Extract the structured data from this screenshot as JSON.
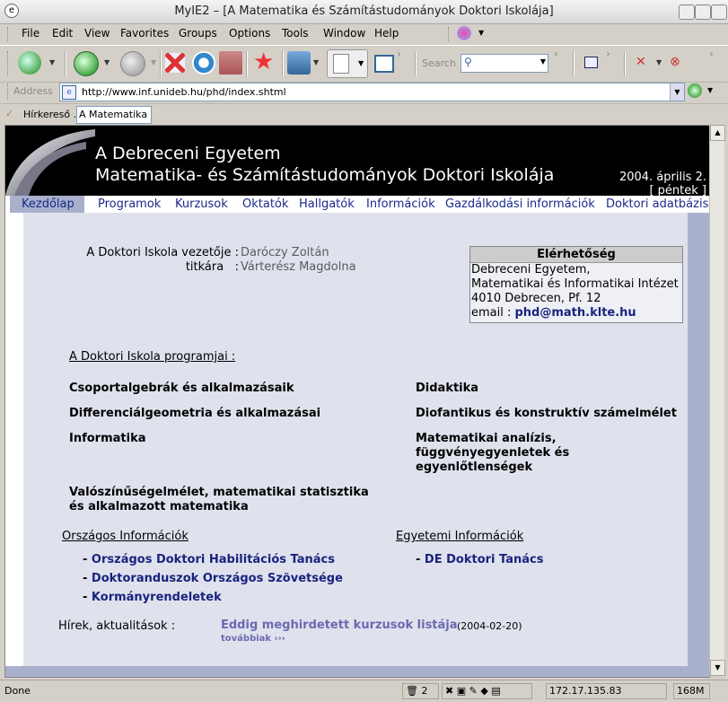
{
  "window": {
    "title": "MyIE2 – [A Matematika és Számítástudományok Doktori Iskolája]"
  },
  "menu": [
    "File",
    "Edit",
    "View",
    "Favorites",
    "Groups",
    "Options",
    "Tools",
    "Window",
    "Help"
  ],
  "toolbar": {
    "search_label": "Search"
  },
  "address": {
    "label": "Address",
    "url": "http://www.inf.unideb.hu/phd/index.shtml"
  },
  "tabs": {
    "hirkereso": "Hírkereső ...",
    "active": "A Matematika ..."
  },
  "page": {
    "header": {
      "line1": "A Debreceni Egyetem",
      "line2": "Matematika- és Számítástudományok Doktori Iskolája",
      "date": "2004. április 2.",
      "day": "[ péntek ]"
    },
    "nav": [
      "Kezdőlap",
      "Programok",
      "Kurzusok",
      "Oktatók",
      "Hallgatók",
      "Információk",
      "Gazdálkodási információk",
      "Doktori adatbázis"
    ],
    "leaders": {
      "head_label": "A Doktori Iskola vezetője :",
      "head_name": "Daróczy Zoltán",
      "sec_label": "titkára   :",
      "sec_name": "Várterész Magdolna"
    },
    "contact": {
      "title": "Elérhetőség",
      "line1": "Debreceni Egyetem,",
      "line2": "Matematikai és Informatikai Intézet",
      "line3": "4010 Debrecen, Pf. 12",
      "email_label": "email : ",
      "email": "phd@math.klte.hu"
    },
    "programs_heading": "A Doktori Iskola programjai :",
    "programs": {
      "p1": "Csoportalgebrák és alkalmazásaik",
      "p2": "Didaktika",
      "p3": "Differenciálgeometria és alkalmazásai",
      "p4": "Diofantikus és konstruktív számelmélet",
      "p5": "Informatika",
      "p6a": "Matematikai analízis,",
      "p6b": "függvényegyenletek és",
      "p6c": "egyenlőtlenségek",
      "p7a": "Valószínűségelmélet, matematikai statisztika",
      "p7b": "és alkalmazott matematika"
    },
    "national": {
      "heading": "Országos Információk",
      "links": [
        "Országos Doktori Habilitációs Tanács",
        "Doktoranduszok Országos Szövetsége",
        "Kormányrendeletek"
      ]
    },
    "university": {
      "heading": "Egyetemi Információk",
      "links": [
        "DE Doktori Tanács"
      ]
    },
    "news": {
      "label": "Hírek, aktualitások :",
      "link": "Eddig meghirdetett kurzusok listája",
      "date": "(2004-02-20)",
      "more": "továbbiak ›››"
    }
  },
  "status": {
    "text": "Done",
    "count": "2",
    "ip": "172.17.135.83",
    "mem": "168M"
  }
}
